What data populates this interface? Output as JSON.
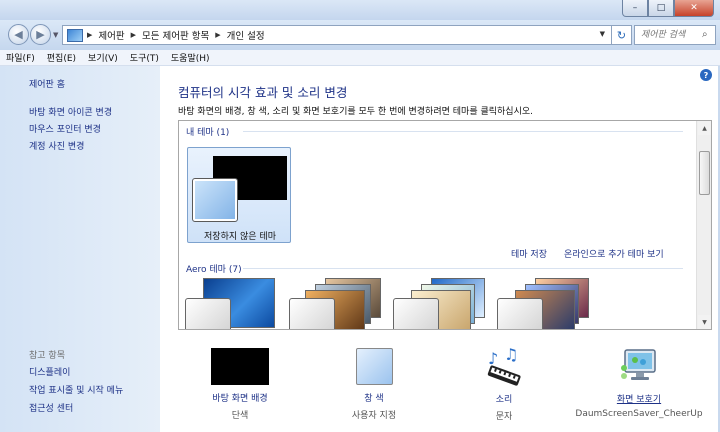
{
  "window": {
    "minimize": "–",
    "maximize": "□",
    "close": "✕"
  },
  "address": {
    "crumbs": [
      "제어판",
      "모든 제어판 항목",
      "개인 설정"
    ],
    "search_placeholder": "제어판 검색"
  },
  "menu": [
    "파일(F)",
    "편집(E)",
    "보기(V)",
    "도구(T)",
    "도움말(H)"
  ],
  "sidebar": {
    "home": "제어판 홈",
    "links": [
      "바탕 화면 아이콘 변경",
      "마우스 포인터 변경",
      "계정 사진 변경"
    ],
    "see_also_heading": "참고 항목",
    "see_also": [
      "디스플레이",
      "작업 표시줄 및 시작 메뉴",
      "접근성 센터"
    ]
  },
  "main": {
    "title": "컴퓨터의 시각 효과 및 소리 변경",
    "description": "바탕 화면의 배경, 창 색, 소리 및 화면 보호기를 모두 한 번에 변경하려면 테마를 클릭하십시오.",
    "my_themes_heading": "내 테마 (1)",
    "unsaved_theme": "저장하지 않은 테마",
    "save_theme": "테마 저장",
    "get_more_online": "온라인으로 추가 테마 보기",
    "aero_heading": "Aero 테마 (7)"
  },
  "bottom": [
    {
      "title": "바탕 화면 배경",
      "sub": "단색"
    },
    {
      "title": "창 색",
      "sub": "사용자 지정"
    },
    {
      "title": "소리",
      "sub": "문자"
    },
    {
      "title": "화면 보호기",
      "sub": "DaumScreenSaver_CheerUp"
    }
  ]
}
